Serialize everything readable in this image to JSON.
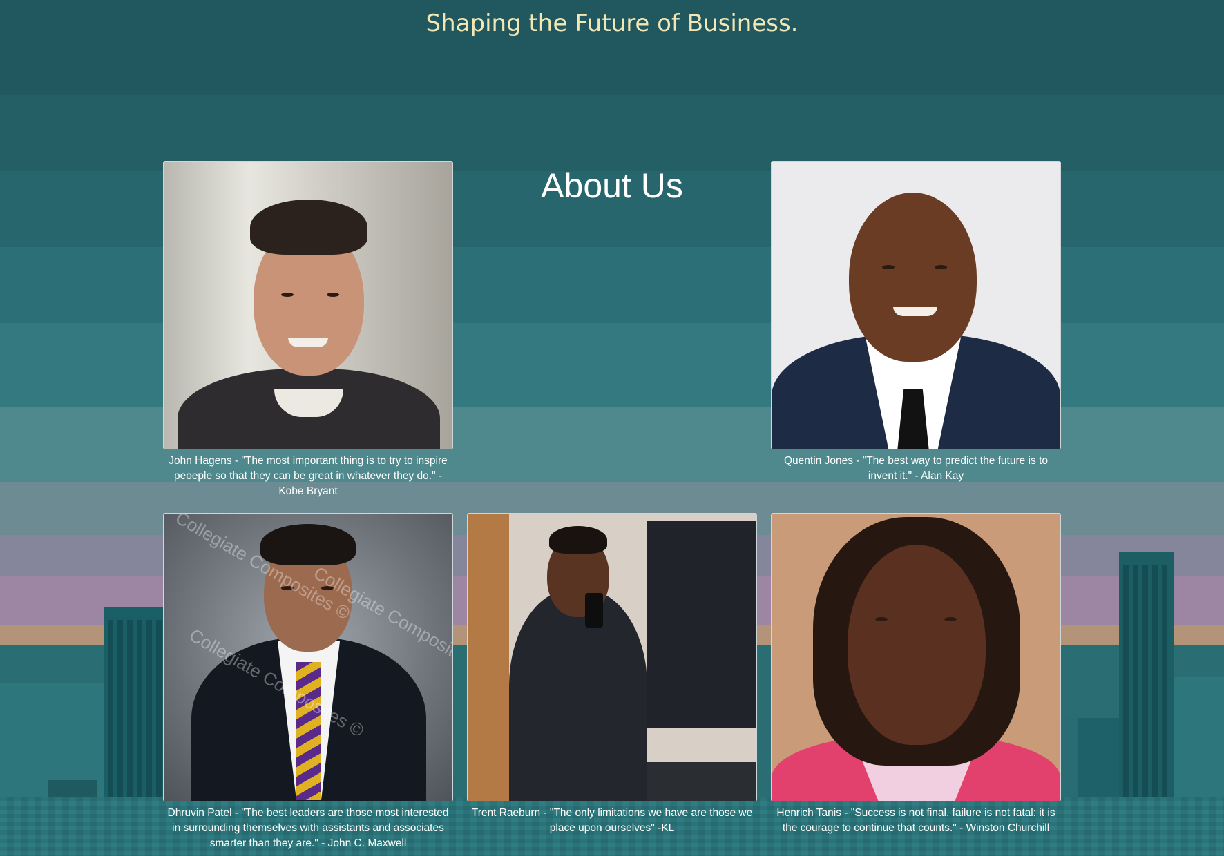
{
  "header": {
    "title": "Shaping the Future of Business."
  },
  "about": {
    "heading": "About Us"
  },
  "members": [
    {
      "name": "John Hagens",
      "caption": "John Hagens - \"The most important thing is to try to inspire peoeple so that they can be great in whatever they do.\" - Kobe Bryant"
    },
    {
      "name": "Quentin Jones",
      "caption": "Quentin Jones - \"The best way to predict the future is to invent it.\" - Alan Kay"
    },
    {
      "name": "Dhruvin Patel",
      "caption": "Dhruvin Patel - \"The best leaders are those most interested in surrounding themselves with assistants and associates smarter than they are.\" - John C. Maxwell"
    },
    {
      "name": "Trent Raeburn",
      "caption": "Trent Raeburn - \"The only limitations we have are those we place upon ourselves\" -KL"
    },
    {
      "name": "Henrich Tanis",
      "caption": "Henrich Tanis - \"Success is not final, failure is not fatal: it is the courage to continue that counts.\" - Winston Churchill"
    }
  ],
  "watermark_text": "Collegiate Composites ©",
  "colors": {
    "title": "#f3e8b4",
    "heading": "#ffffff",
    "background_top": "#21575e",
    "skyline": "#1b5a61"
  }
}
